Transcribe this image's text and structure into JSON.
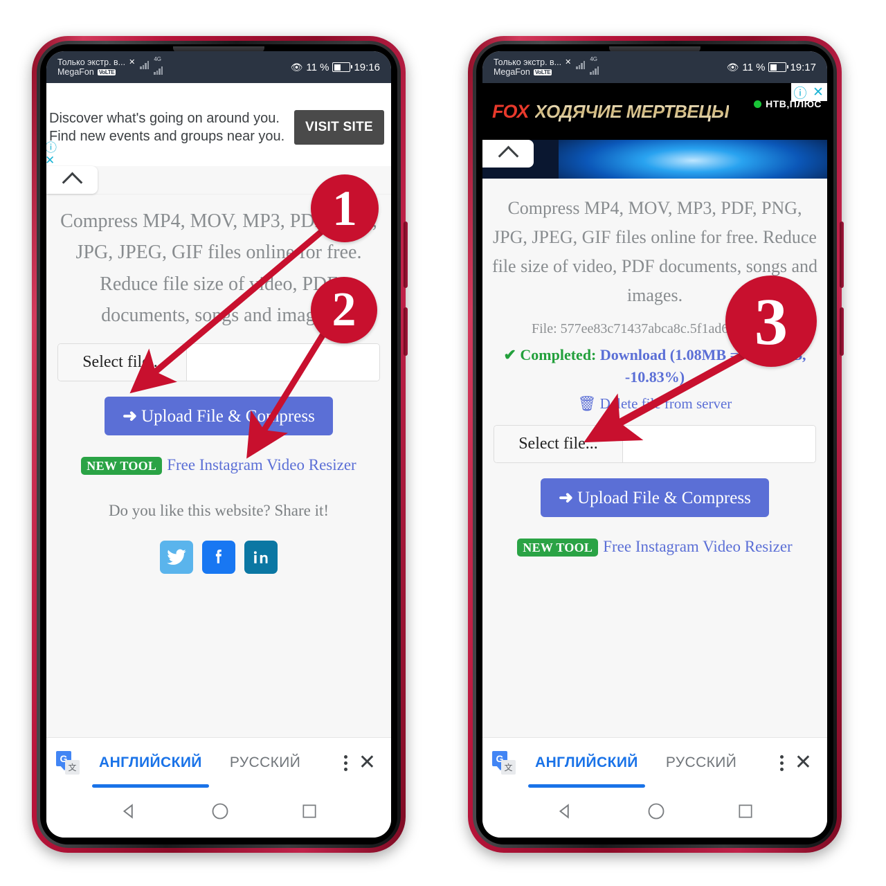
{
  "status_bar": {
    "carrier_top": "Только экстр. в...",
    "carrier_bottom": "MegaFon",
    "volte_badge": "VoLTE",
    "x_mark": "✕",
    "net_label": "4G",
    "battery_percent": "11 %",
    "time_left": "19:16",
    "time_right": "19:17"
  },
  "left_phone": {
    "ad": {
      "text": "Discover what's going on around you. Find new events and groups near you.",
      "cta_label": "VISIT SITE",
      "info_icon": "ⓘ",
      "close_icon": "✕"
    },
    "page": {
      "description": "Compress MP4, MOV, MP3, PDF, PNG, JPG, JPEG, GIF files online for free. Reduce file size of video, PDF documents, songs and images.",
      "select_file_label": "Select file...",
      "select_file_value": "",
      "upload_button": "Upload File & Compress",
      "upload_arrow": "➜",
      "new_tool_badge": "NEW TOOL",
      "new_tool_link": "Free Instagram Video Resizer",
      "share_prompt": "Do you like this website? Share it!",
      "socials": [
        "twitter-icon",
        "facebook-icon",
        "linkedin-icon"
      ]
    }
  },
  "right_phone": {
    "ad": {
      "fox_logo": "FOX",
      "fox_title": "ХОДЯЧИЕ МЕРТВЕЦЫ",
      "sponsor": "НТВ‚ПЛЮС",
      "info_icon": "ⓘ",
      "close_icon": "✕"
    },
    "page": {
      "description": "Compress MP4, MOV, MP3, PDF, PNG, JPG, JPEG, GIF files online for free. Reduce file size of video, PDF documents, songs and images.",
      "file_info": "File: 577ee83c71437abca8c.5f1ad64c9ae5...",
      "completed_check": "✔",
      "completed_label": "Completed:",
      "download_text": "Download (1.08MB => 0.97MB, -10.83%)",
      "delete_icon": "🗑",
      "delete_label": "Delete file from server",
      "select_file_label": "Select file...",
      "select_file_value": "",
      "upload_button": "Upload File & Compress",
      "upload_arrow": "➜",
      "new_tool_badge": "NEW TOOL",
      "new_tool_link": "Free Instagram Video Resizer"
    }
  },
  "translate_bar": {
    "tab_active": "АНГЛИЙСКИЙ",
    "tab_inactive": "РУССКИЙ",
    "menu_icon": "kebab-menu-icon",
    "close_icon": "✕",
    "logo_letter": "G",
    "logo_glyph": "文"
  },
  "nav_bar": {
    "back": "back-icon",
    "home": "home-icon",
    "recents": "recents-icon"
  },
  "markers": {
    "one": "1",
    "two": "2",
    "three": "3"
  },
  "colors": {
    "accent_blue": "#5b6fd6",
    "success_green": "#23a03c",
    "marker_red": "#c8102e",
    "badge_green": "#2aa345",
    "translate_blue": "#1a73e8",
    "frame_red": "#b7143a"
  }
}
